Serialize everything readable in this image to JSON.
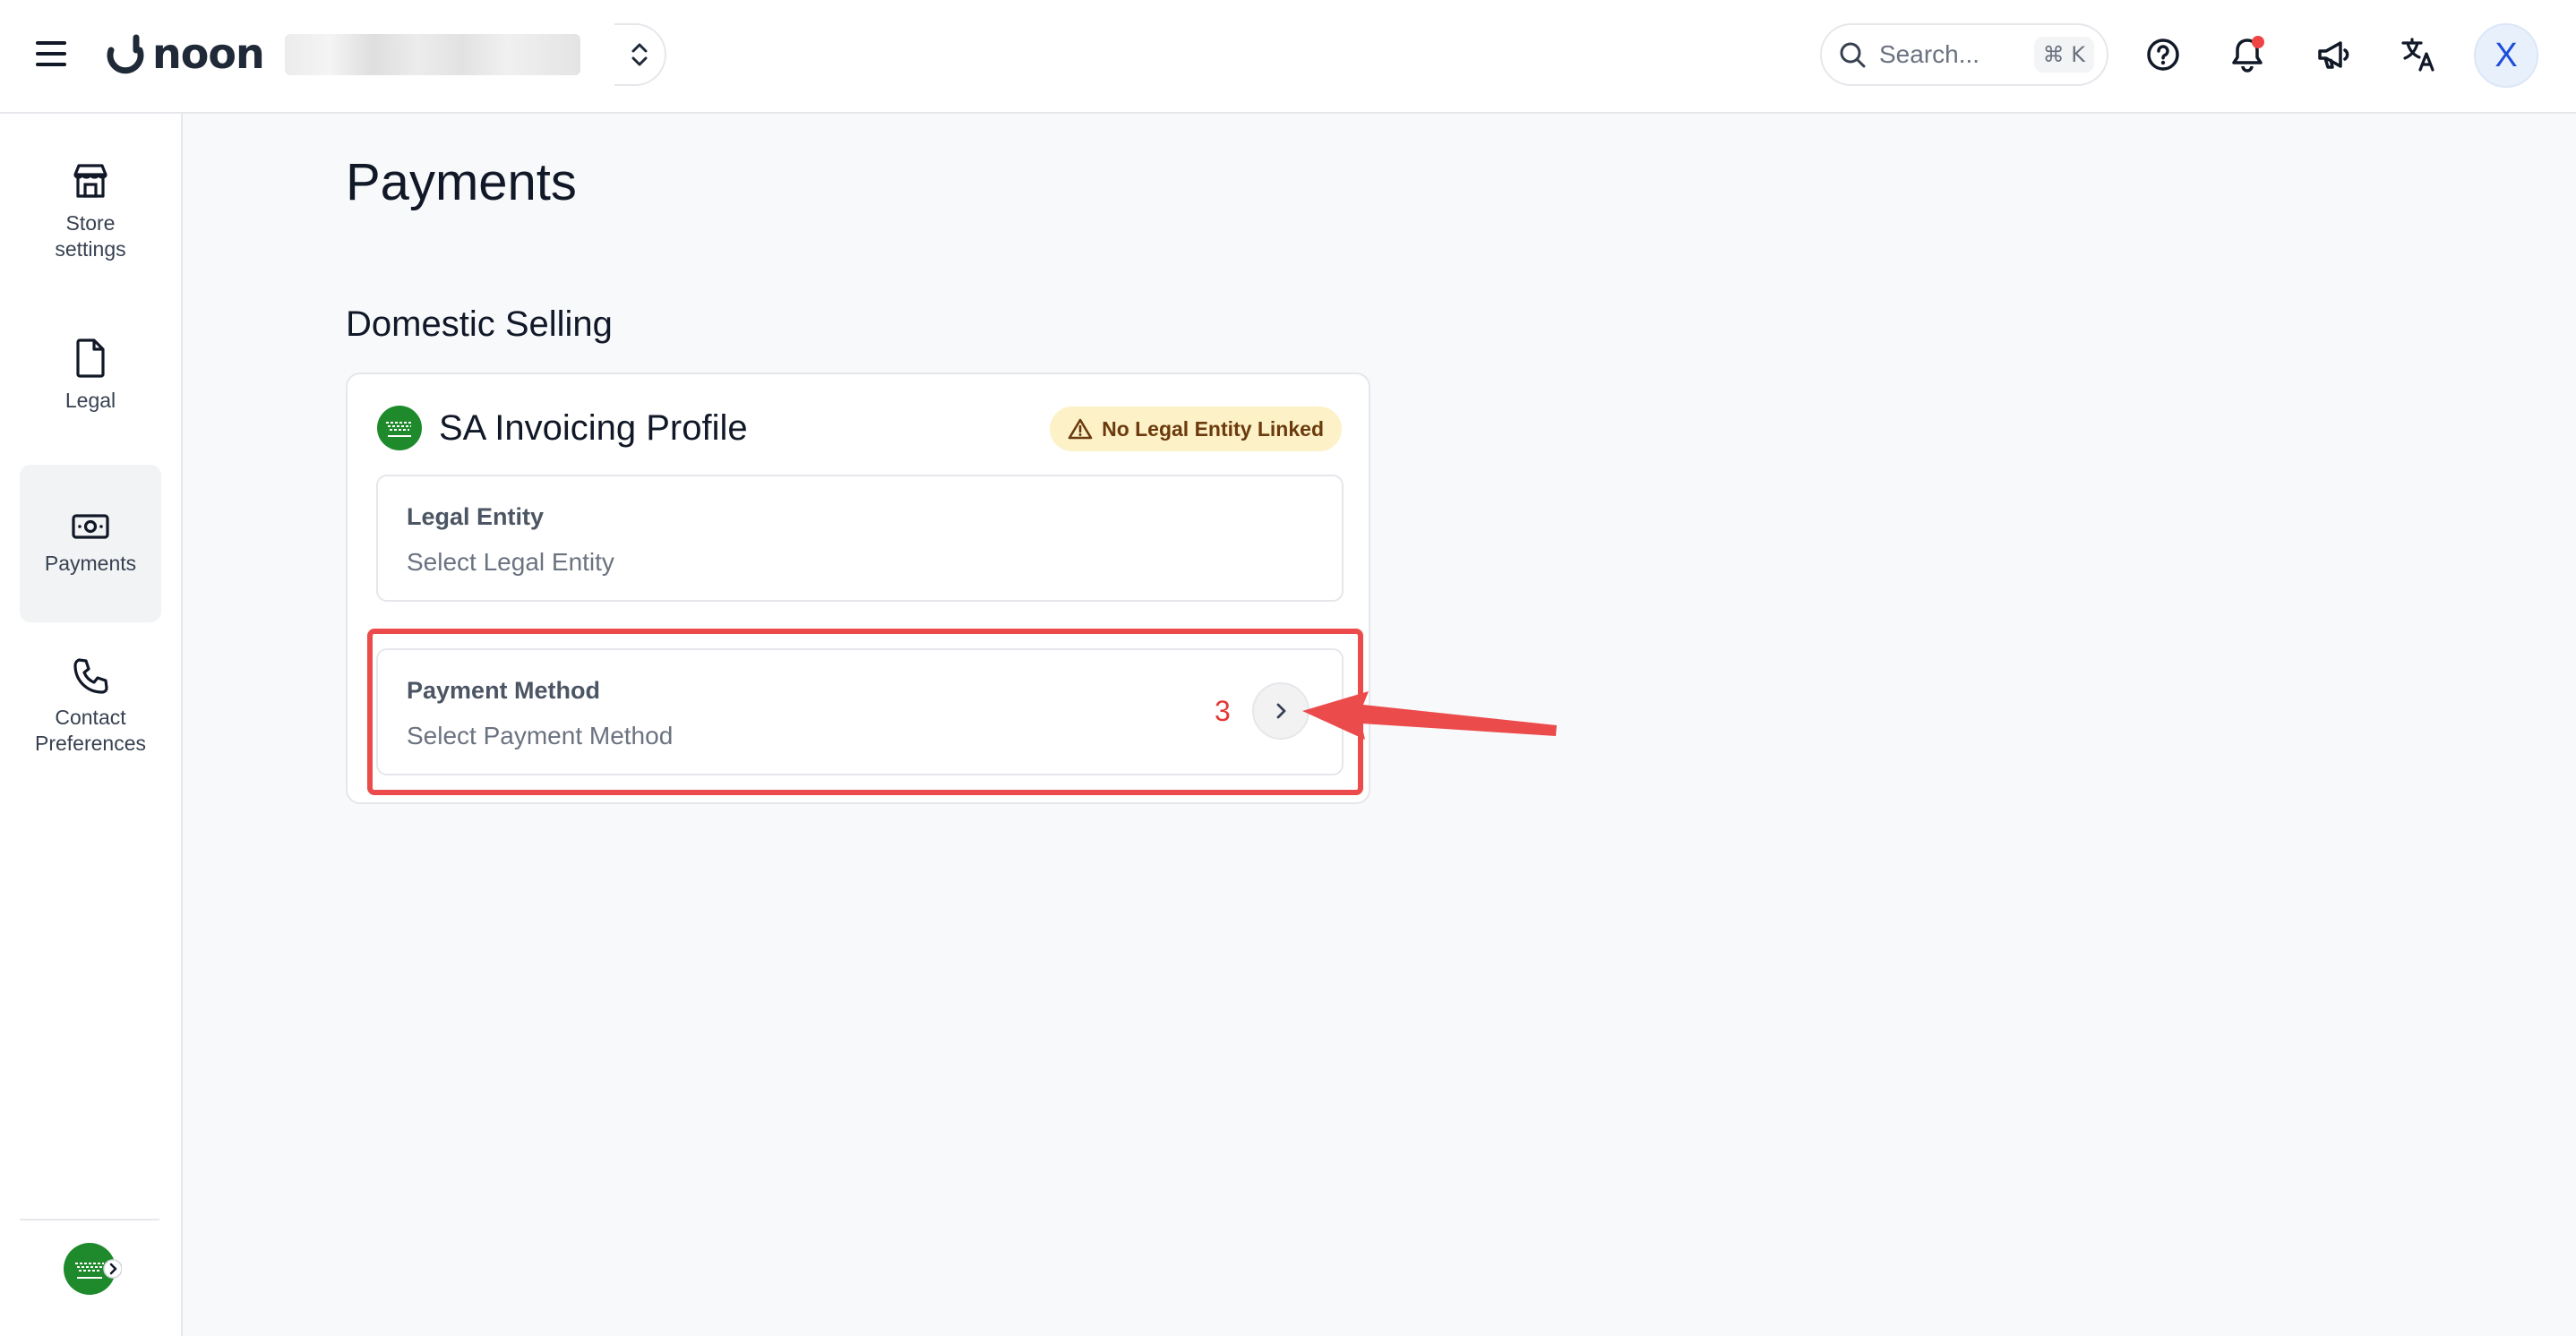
{
  "header": {
    "logo_text": "noon",
    "store_name": "",
    "search_placeholder": "Search...",
    "search_shortcut": "⌘ K",
    "avatar_initial": "X",
    "notification_dot_color": "#ef4444"
  },
  "sidebar": {
    "items": [
      {
        "label": "Store settings",
        "icon": "store-icon"
      },
      {
        "label": "Legal",
        "icon": "document-icon"
      },
      {
        "label": "Payments",
        "icon": "cash-icon",
        "active": true
      },
      {
        "label": "Contact Preferences",
        "icon": "phone-icon"
      }
    ],
    "country_icon": "saudi-flag-icon"
  },
  "main": {
    "title": "Payments",
    "section_title": "Domestic Selling",
    "card": {
      "title": "SA Invoicing Profile",
      "flag_icon": "saudi-flag-icon",
      "badge": "No Legal Entity Linked",
      "badge_color": "#fdf1c7",
      "fields": [
        {
          "label": "Legal Entity",
          "value": "Select Legal Entity"
        },
        {
          "label": "Payment Method",
          "value": "Select Payment Method"
        }
      ]
    },
    "annotation": {
      "step": "3",
      "color": "#ec4b4b"
    }
  }
}
